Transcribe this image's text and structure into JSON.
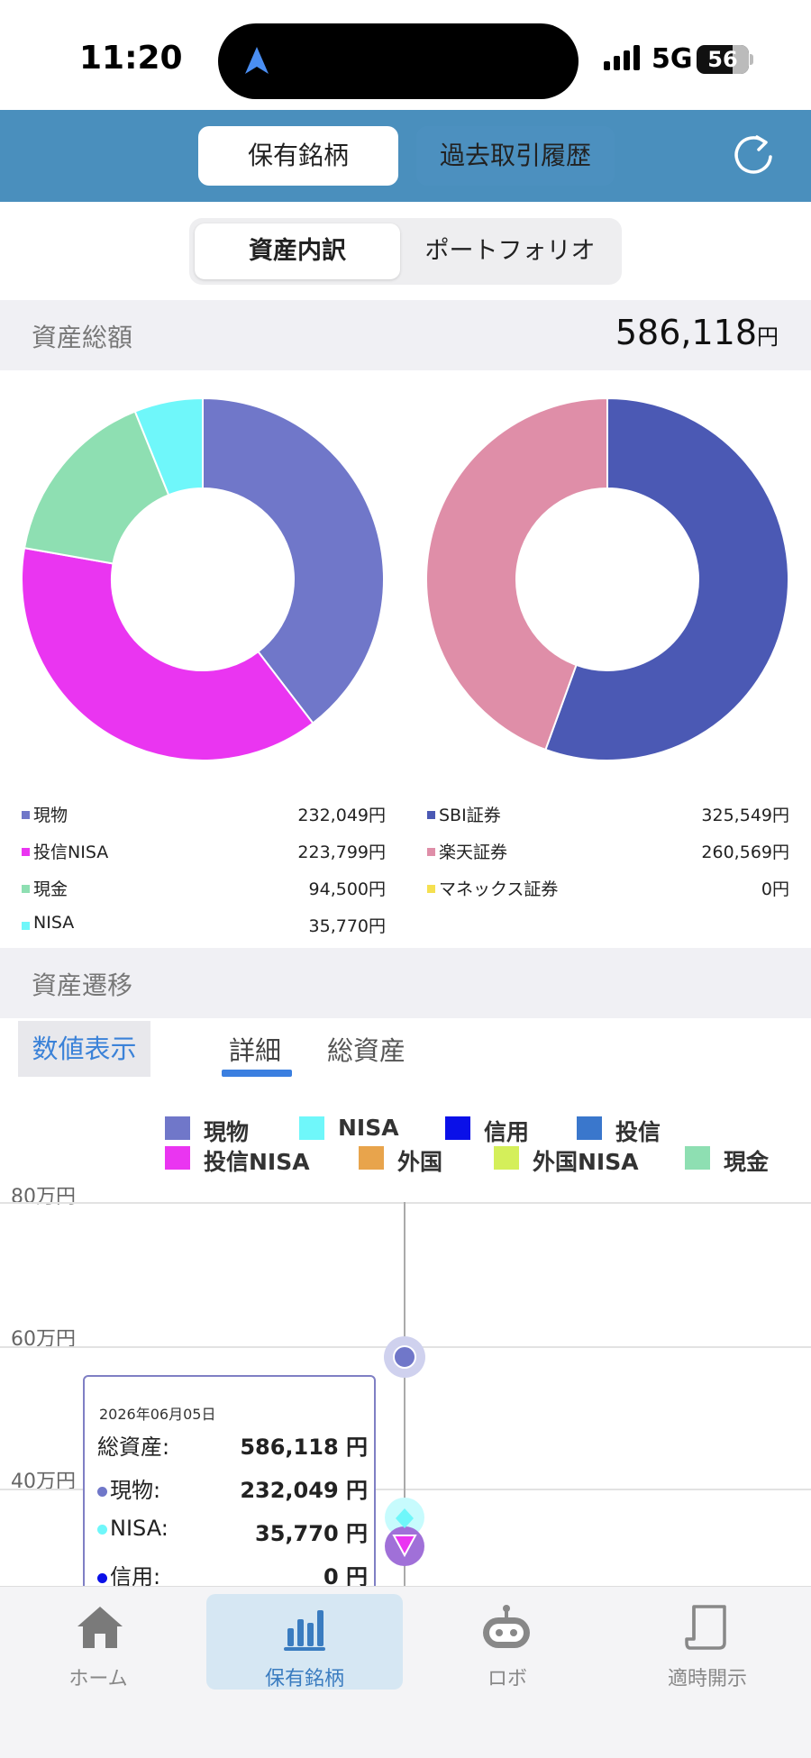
{
  "status_bar": {
    "time": "11:20",
    "network": "5G",
    "battery": "56"
  },
  "top_tabs": {
    "active": "保有銘柄",
    "other": "過去取引履歴"
  },
  "segment": {
    "active": "資産内訳",
    "other": "ポートフォリオ"
  },
  "assets": {
    "title": "資産総額",
    "total": "586,118",
    "unit": "円"
  },
  "donut_left": [
    {
      "name": "現物",
      "value": "232,049円",
      "amount": 232049,
      "color": "#7077c9"
    },
    {
      "name": "投信NISA",
      "value": "223,799円",
      "amount": 223799,
      "color": "#ea35f1"
    },
    {
      "name": "現金",
      "value": "94,500円",
      "amount": 94500,
      "color": "#8edfb2"
    },
    {
      "name": "NISA",
      "value": "35,770円",
      "amount": 35770,
      "color": "#6ff7fa"
    }
  ],
  "donut_right": [
    {
      "name": "SBI証券",
      "value": "325,549円",
      "amount": 325549,
      "color": "#4b59b4"
    },
    {
      "name": "楽天証券",
      "value": "260,569円",
      "amount": 260569,
      "color": "#df8ea8"
    },
    {
      "name": "マネックス証券",
      "value": "0円",
      "amount": 0,
      "color": "#f5e050"
    }
  ],
  "transition": {
    "title": "資産遷移",
    "number_button": "数値表示",
    "tab_detail": "詳細",
    "tab_total": "総資産"
  },
  "chart_legend": [
    {
      "name": "現物",
      "color": "#7077c9"
    },
    {
      "name": "NISA",
      "color": "#6ff7fa"
    },
    {
      "name": "信用",
      "color": "#0a10e8"
    },
    {
      "name": "投信",
      "color": "#3a77cc"
    },
    {
      "name": "投信NISA",
      "color": "#ea35f1"
    },
    {
      "name": "外国",
      "color": "#e8a44c"
    },
    {
      "name": "外国NISA",
      "color": "#d4ef5a"
    },
    {
      "name": "現金",
      "color": "#8edfb2"
    }
  ],
  "chart_data": {
    "type": "area",
    "y_tick_labels": [
      "80万円",
      "60万円",
      "40万円"
    ],
    "series": [
      {
        "name": "現物",
        "values": [
          232049
        ]
      },
      {
        "name": "NISA",
        "values": [
          35770
        ]
      },
      {
        "name": "信用",
        "values": [
          0
        ]
      }
    ]
  },
  "tooltip": {
    "date": "2026年06月05日",
    "rows": [
      {
        "label": "総資産:",
        "value": "586,118 円",
        "dot": ""
      },
      {
        "label": "現物:",
        "value": "232,049 円",
        "dot": "#7077c9"
      },
      {
        "label": "NISA:",
        "value": "35,770 円",
        "dot": "#6ff7fa"
      },
      {
        "label": "信用:",
        "value": "0 円",
        "dot": "#0a10e8"
      }
    ]
  },
  "bottom_nav": [
    {
      "label": "ホーム",
      "icon": "home-icon"
    },
    {
      "label": "保有銘柄",
      "icon": "bar-chart-icon"
    },
    {
      "label": "ロボ",
      "icon": "robot-icon"
    },
    {
      "label": "適時開示",
      "icon": "document-icon"
    }
  ]
}
